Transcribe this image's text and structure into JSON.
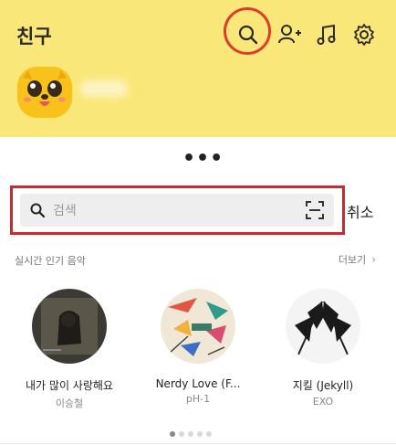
{
  "header": {
    "title": "친구",
    "icons": [
      "search-icon",
      "add-friend-icon",
      "music-icon",
      "settings-icon"
    ],
    "background": "#fae77a",
    "highlight_color": "#e03a2b"
  },
  "search": {
    "placeholder": "검색",
    "cancel_label": "취소",
    "highlight_color": "#d5262e"
  },
  "music": {
    "section_title": "실시간 인기 음악",
    "more_label": "더보기",
    "songs": [
      {
        "title": "내가 많이 사랑해요",
        "artist": "이승철",
        "cover_icon": "album-cover-dark"
      },
      {
        "title": "Nerdy Love (F...",
        "artist": "pH-1",
        "cover_icon": "album-cover-colorful"
      },
      {
        "title": "지킬 (Jekyll)",
        "artist": "EXO",
        "cover_icon": "album-cover-flags"
      }
    ],
    "pagination": {
      "total": 5,
      "active": 1
    }
  }
}
